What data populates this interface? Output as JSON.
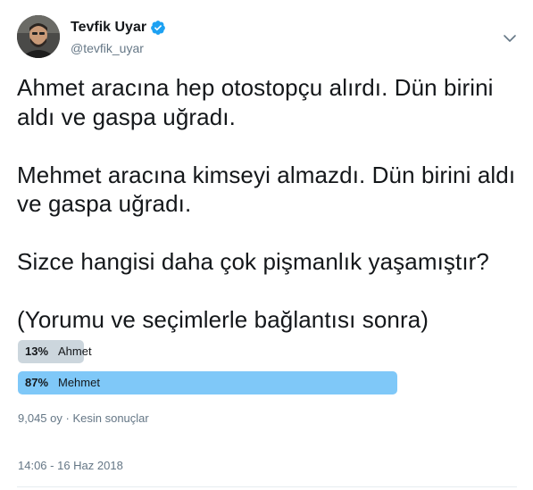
{
  "author": {
    "display_name": "Tevfik Uyar",
    "handle": "@tevfik_uyar",
    "verified": true,
    "verified_color": "#1da1f2",
    "avatar_icon": "profile-photo"
  },
  "tweet": {
    "paragraphs": [
      "Ahmet aracına hep otostopçu alırdı. Dün birini aldı ve gaspa uğradı.",
      "Mehmet aracına kimseyi almazdı. Dün birini aldı ve gaspa uğradı.",
      "Sizce hangisi daha çok pişmanlık yaşamıştır?",
      "(Yorumu ve seçimlerle bağlantısı sonra)"
    ]
  },
  "poll": {
    "options": [
      {
        "percent_label": "13%",
        "label": "Ahmet",
        "fraction": 0.13,
        "winner": false
      },
      {
        "percent_label": "87%",
        "label": "Mehmet",
        "fraction": 0.87,
        "winner": true
      }
    ],
    "winner_color": "#7fc8f8",
    "loser_color": "#ccd6dd",
    "votes": "9,045 oy",
    "separator": "·",
    "status": "Kesin sonuçlar"
  },
  "timestamp": "14:06 - 16 Haz 2018",
  "menu_icon": "chevron-down"
}
